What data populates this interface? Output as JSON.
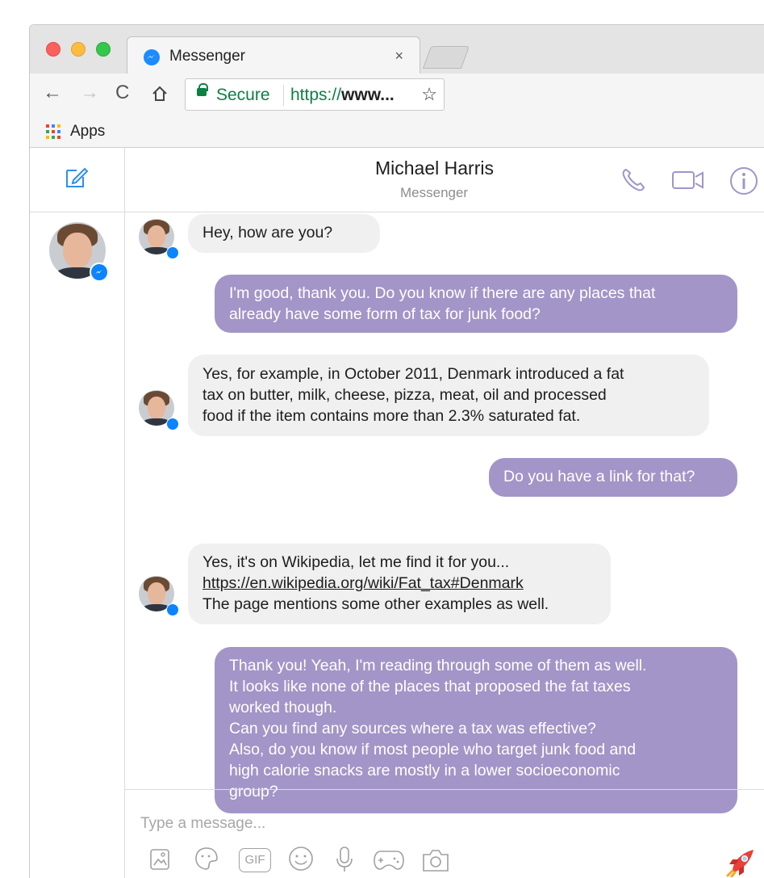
{
  "browser": {
    "tab": {
      "title": "Messenger",
      "close_glyph": "×",
      "icon": "messenger-icon"
    },
    "nav": {
      "back": "←",
      "forward": "→",
      "reload": "C",
      "home": "⌂"
    },
    "address": {
      "secure_label": "Secure",
      "url_scheme": "https://",
      "url_rest": "www...",
      "star": "☆"
    },
    "bookmarks": {
      "apps_label": "Apps"
    }
  },
  "sidebar": {
    "compose_icon": "compose-icon",
    "conversation": {
      "avatar": "contact-avatar",
      "badge_icon": "messenger-badge-icon"
    }
  },
  "header": {
    "name": "Michael Harris",
    "subtitle": "Messenger",
    "icons": [
      "phone-icon",
      "video-icon",
      "info-icon"
    ]
  },
  "messages": [
    {
      "from": "them",
      "lines": [
        "Hey, how are you?"
      ]
    },
    {
      "from": "me",
      "lines": [
        "I'm good, thank you. Do you know if there are any places that",
        "already have some form of tax for junk food?"
      ]
    },
    {
      "from": "them",
      "lines": [
        "Yes, for example, in October 2011, Denmark introduced a fat",
        "tax on butter, milk, cheese, pizza, meat, oil and processed",
        "food if the item contains more than 2.3% saturated fat."
      ]
    },
    {
      "from": "me",
      "lines": [
        "Do you have a link for that?"
      ]
    },
    {
      "from": "them",
      "lines": [
        "Yes, it's on Wikipedia, let me find it for you...",
        "https://en.wikipedia.org/wiki/Fat_tax#Denmark",
        "The page mentions some other examples as well."
      ]
    },
    {
      "from": "me",
      "lines": [
        "Thank you! Yeah, I'm reading through some of them as well.",
        "It looks like none of the places that proposed the fat taxes",
        "worked though.",
        "Can you find any sources where a tax was effective?",
        "Also, do you know if most people who target junk food and",
        "high calorie snacks are mostly in a lower socioeconomic",
        "group?"
      ]
    }
  ],
  "composer": {
    "placeholder": "Type a message...",
    "gif_label": "GIF",
    "icons": [
      "image-icon",
      "sticker-icon",
      "gif-icon",
      "emoji-icon",
      "microphone-icon",
      "game-icon",
      "camera-icon",
      "rocket-icon"
    ]
  },
  "colors": {
    "outgoing_bubble": "#a395c7",
    "incoming_bubble": "#f0f0f0",
    "accent": "#0a84ff",
    "header_icons": "#a095c9",
    "secure_green": "#0b8043"
  }
}
